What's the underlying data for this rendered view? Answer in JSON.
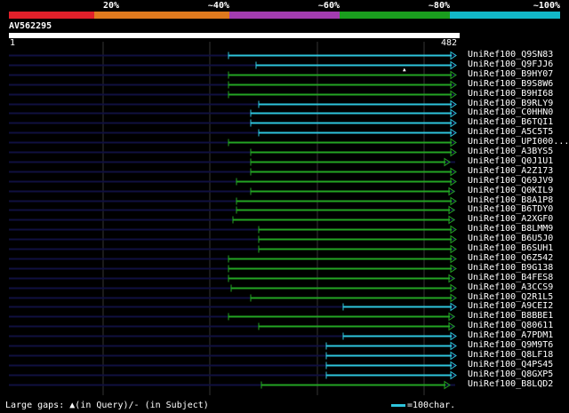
{
  "scale": {
    "labels": [
      "20%",
      "~40%",
      "~60%",
      "~80%",
      "~100%"
    ],
    "colors": [
      "#e0202a",
      "#e07a1e",
      "#a33cb0",
      "#1a9e1e",
      "#12b8c8"
    ]
  },
  "query": {
    "id": "AV562295",
    "start": "1",
    "end": "482"
  },
  "hits": [
    {
      "id": "UniRef100_Q9SN83",
      "color": "cyan"
    },
    {
      "id": "UniRef100_Q9FJJ6",
      "color": "cyan"
    },
    {
      "id": "UniRef100_B9HY07",
      "color": "green"
    },
    {
      "id": "UniRef100_B9S8W6",
      "color": "green"
    },
    {
      "id": "UniRef100_B9HI68",
      "color": "green"
    },
    {
      "id": "UniRef100_B9RLY9",
      "color": "cyan"
    },
    {
      "id": "UniRef100_C0HHN0",
      "color": "cyan"
    },
    {
      "id": "UniRef100_B6TQI1",
      "color": "cyan"
    },
    {
      "id": "UniRef100_A5C5T5",
      "color": "cyan"
    },
    {
      "id": "UniRef100_UPI000...",
      "color": "green"
    },
    {
      "id": "UniRef100_A3BYS5",
      "color": "green"
    },
    {
      "id": "UniRef100_Q0J1U1",
      "color": "green"
    },
    {
      "id": "UniRef100_A2Z173",
      "color": "green"
    },
    {
      "id": "UniRef100_Q69JV9",
      "color": "green"
    },
    {
      "id": "UniRef100_Q0KIL9",
      "color": "green"
    },
    {
      "id": "UniRef100_B8A1P8",
      "color": "green"
    },
    {
      "id": "UniRef100_B6TDY0",
      "color": "green"
    },
    {
      "id": "UniRef100_A2XGF0",
      "color": "green"
    },
    {
      "id": "UniRef100_B8LMM9",
      "color": "green"
    },
    {
      "id": "UniRef100_B6U5J0",
      "color": "green"
    },
    {
      "id": "UniRef100_B6SUH1",
      "color": "green"
    },
    {
      "id": "UniRef100_Q6Z542",
      "color": "green"
    },
    {
      "id": "UniRef100_B9G138",
      "color": "green"
    },
    {
      "id": "UniRef100_B4FES8",
      "color": "green"
    },
    {
      "id": "UniRef100_A3CCS9",
      "color": "green"
    },
    {
      "id": "UniRef100_Q2R1L5",
      "color": "green"
    },
    {
      "id": "UniRef100_A9CEI2",
      "color": "cyan"
    },
    {
      "id": "UniRef100_B8BBE1",
      "color": "green"
    },
    {
      "id": "UniRef100_Q80611",
      "color": "green"
    },
    {
      "id": "UniRef100_A7PDM1",
      "color": "cyan"
    },
    {
      "id": "UniRef100_Q9M9T6",
      "color": "cyan"
    },
    {
      "id": "UniRef100_Q8LF18",
      "color": "cyan"
    },
    {
      "id": "UniRef100_Q4PS45",
      "color": "cyan"
    },
    {
      "id": "UniRef100_Q8GXP5",
      "color": "cyan"
    },
    {
      "id": "UniRef100_B8LQD2",
      "color": "green"
    }
  ],
  "legend": {
    "gaps_prefix": "Large gaps:",
    "gaps_query": "(in Query)/",
    "gaps_dash": "-",
    "gaps_subject": " (in Subject)",
    "scale_text": "=100char."
  },
  "palette": {
    "cyan": "#2ec4dc",
    "green": "#23a423",
    "track": "#101040",
    "grid": "#333333"
  }
}
